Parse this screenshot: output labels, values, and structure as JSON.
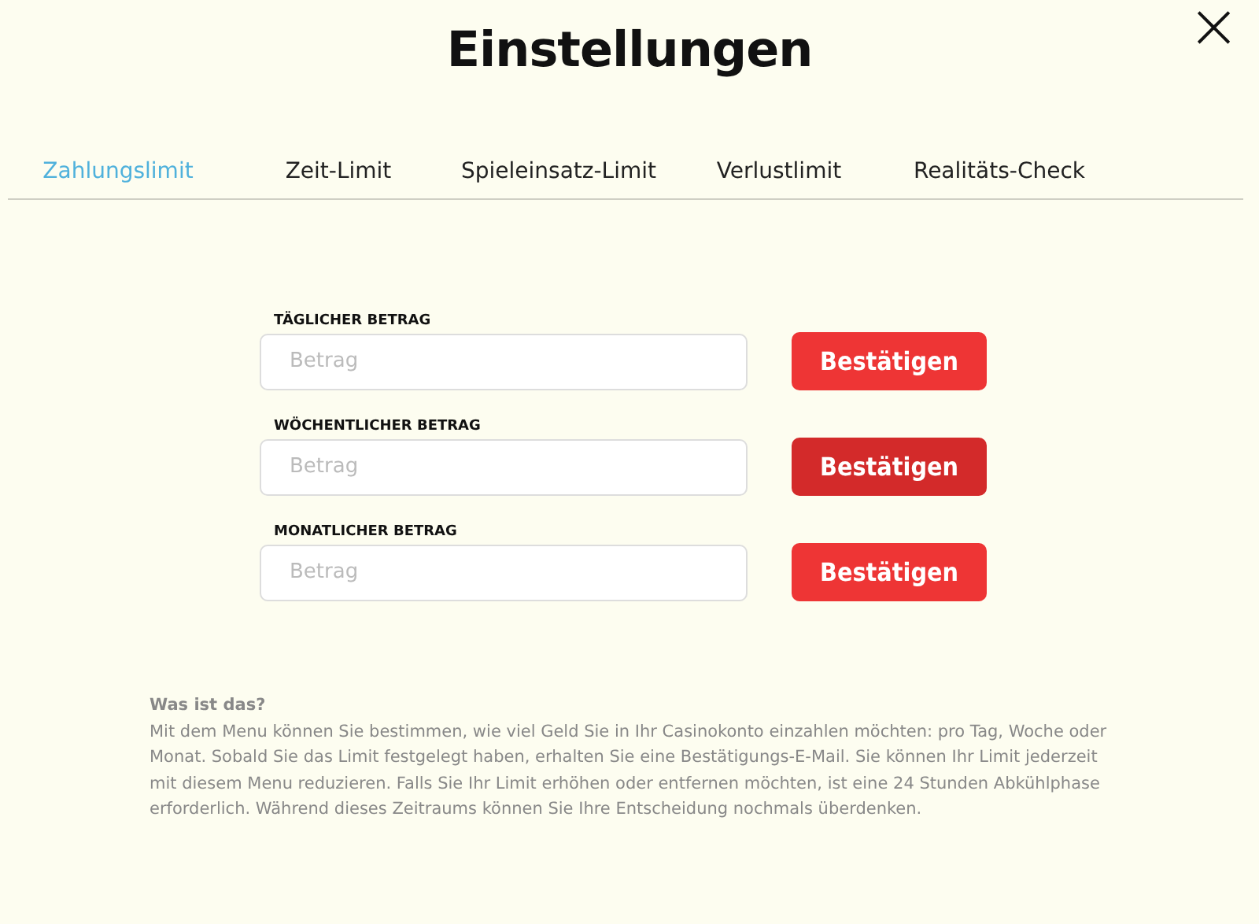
{
  "title": "Einstellungen",
  "close": {
    "symbol": "×"
  },
  "tabs": [
    {
      "label": "Zahlungslimit",
      "selected": true
    },
    {
      "label": "Zeit-Limit",
      "selected": false
    },
    {
      "label": "Spieleinsatz-Limit",
      "selected": false
    },
    {
      "label": "Verlustlimit",
      "selected": false
    },
    {
      "label": "Realitäts-Check",
      "selected": false
    }
  ],
  "limits": [
    {
      "label": "TÄGLICHER BETRAG",
      "placeholder": "Betrag",
      "button": "Bestätigen",
      "highlighted": false
    },
    {
      "label": "WÖCHENTLICHER BETRAG",
      "placeholder": "Betrag",
      "button": "Bestätigen",
      "highlighted": true
    },
    {
      "label": "MONATLICHER BETRAG",
      "placeholder": "Betrag",
      "button": "Bestätigen",
      "highlighted": false
    }
  ],
  "info": {
    "heading": "Was ist das?",
    "text": "Mit dem Menu können Sie bestimmen, wie viel Geld Sie in Ihr Casinokonto einzahlen möchten: pro Tag, Woche oder Monat. Sobald Sie das Limit festgelegt haben, erhalten Sie eine Bestätigungs-E-Mail. Sie können Ihr Limit jederzeit mit diesem Menu reduzieren. Falls Sie Ihr Limit erhöhen oder entfernen möchten, ist eine 24 Stunden Abkühlphase erforderlich. Während dieses Zeitraums können Sie Ihre Entscheidung nochmals überdenken."
  }
}
